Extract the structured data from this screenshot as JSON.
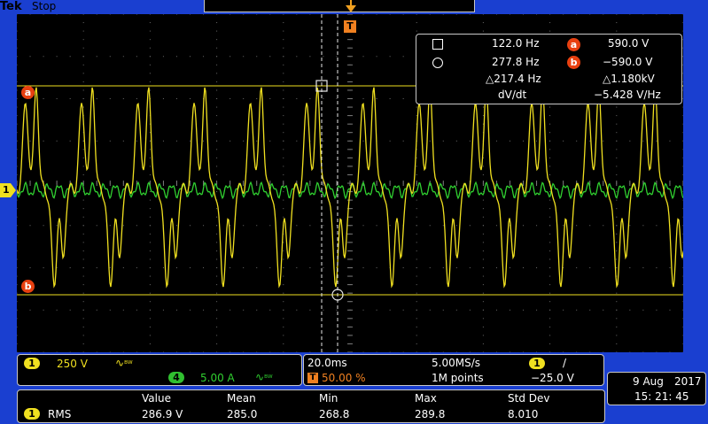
{
  "top_bar": {
    "brand": "Tek",
    "acq_state": "Stop"
  },
  "trigger_marker": {
    "label": "T"
  },
  "cursors": {
    "a_label": "a",
    "b_label": "b",
    "square_freq": "122.0 Hz",
    "circle_freq": "277.8 Hz",
    "delta_freq": "△217.4 Hz",
    "a_value": "590.0 V",
    "b_value": "−590.0 V",
    "delta_value": "△1.180kV",
    "dvdt_label": "dV/dt",
    "dvdt_value": "−5.428 V/Hz"
  },
  "ch1_marker": "1",
  "channel_readout": {
    "ch1_badge": "1",
    "ch1_scale": "250 V",
    "ch1_bw": "ᴮᵂ",
    "ch4_badge": "4",
    "ch4_scale": "5.00 A",
    "ch4_bw": "ᴮᵂ"
  },
  "horizontal": {
    "timebase": "20.0ms",
    "trigger_pos_badge": "T",
    "trigger_pos": "50.00 %",
    "sample_rate": "5.00MS/s",
    "record_length": "1M points",
    "trig_source_badge": "1",
    "trig_slope": "/",
    "trig_level": "−25.0 V"
  },
  "measurement": {
    "headers": [
      "Value",
      "Mean",
      "Min",
      "Max",
      "Std Dev"
    ],
    "row": {
      "badge": "1",
      "name": "RMS",
      "values": [
        "286.9 V",
        "285.0",
        "268.8",
        "289.8",
        "8.010"
      ]
    }
  },
  "date": {
    "day_month": "9 Aug",
    "year": "2017",
    "time": "15: 21: 45"
  },
  "colors": {
    "ch1": "#f0e020",
    "ch4": "#30d030",
    "frame": "#1a3fd0",
    "cursor_marker": "#e84010"
  }
}
